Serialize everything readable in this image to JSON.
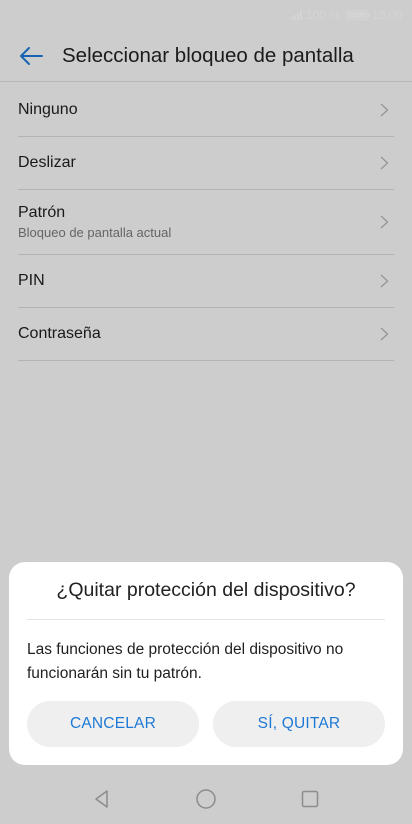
{
  "status_bar": {
    "battery_text": "100 %",
    "time": "10:00"
  },
  "header": {
    "title": "Seleccionar bloqueo de pantalla",
    "back_icon": "back-arrow-icon"
  },
  "lock_options": [
    {
      "title": "Ninguno",
      "subtitle": ""
    },
    {
      "title": "Deslizar",
      "subtitle": ""
    },
    {
      "title": "Patrón",
      "subtitle": "Bloqueo de pantalla actual"
    },
    {
      "title": "PIN",
      "subtitle": ""
    },
    {
      "title": "Contraseña",
      "subtitle": ""
    }
  ],
  "dialog": {
    "title": "¿Quitar protección del dispositivo?",
    "message": "Las funciones de protección del dispositivo no funcionarán sin tu patrón.",
    "cancel_label": "CANCELAR",
    "confirm_label": "SÍ, QUITAR"
  },
  "navigation_bar": {
    "icons": [
      "back-triangle-icon",
      "home-circle-icon",
      "recents-square-icon"
    ]
  },
  "colors": {
    "accent": "#1e79d6",
    "scrim": "rgba(0,0,0,0.17)"
  }
}
